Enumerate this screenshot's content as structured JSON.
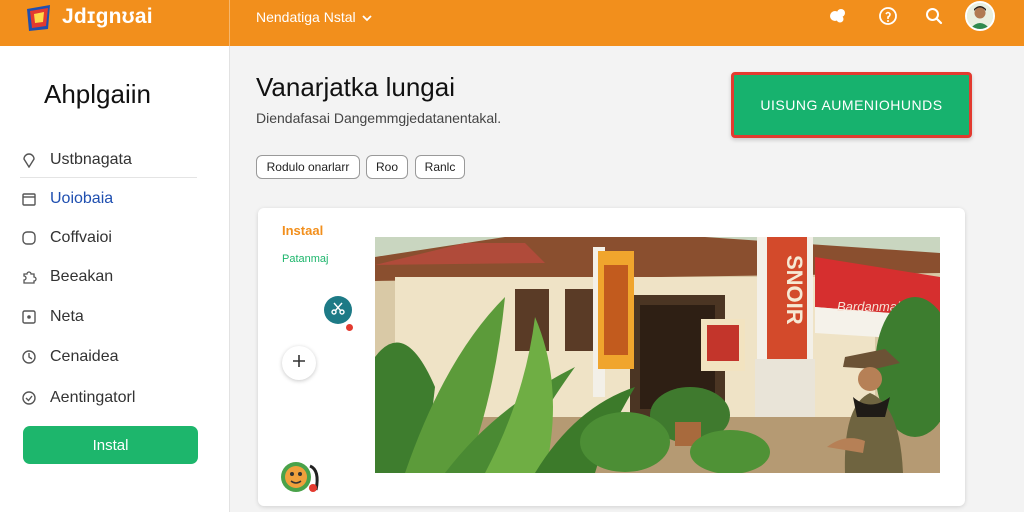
{
  "header": {
    "brand_name": "Jdɪgnʊai",
    "nav_select": "Nendatiga Nstal"
  },
  "sidebar": {
    "title": "Ahplgaiin",
    "items": [
      {
        "label": "Ustbnagata",
        "icon": "map-pin-icon"
      },
      {
        "label": "Uoiobaia",
        "icon": "calendar-icon"
      },
      {
        "label": "Coffvaioi",
        "icon": "chat-bubble-icon"
      },
      {
        "label": "Beeakan",
        "icon": "puzzle-icon"
      },
      {
        "label": "Neta",
        "icon": "square-dot-icon"
      },
      {
        "label": "Cenaidea",
        "icon": "clock-icon"
      },
      {
        "label": "Aentingatorl",
        "icon": "check-circle-icon"
      }
    ],
    "action_label": "Instal"
  },
  "main": {
    "title": "Vanarjatka lungai",
    "subtitle": "Diendafasai Dangemmgjedatanentakal.",
    "cta_label": "UISUNG AUMENIOHUNDS",
    "chips": [
      "Rodulo onarlarr",
      "Roo",
      "Ranlc"
    ]
  },
  "card": {
    "label": "Instaal",
    "sub_label": "Patanmaj",
    "photo_banner_text": "Bardanmaja",
    "photo_pole_text": "SNOIR"
  },
  "colors": {
    "topbar": "#f28f1c",
    "accent_green": "#1db66c",
    "cta_border": "#e33a2f",
    "active_link": "#1f4fb0"
  }
}
